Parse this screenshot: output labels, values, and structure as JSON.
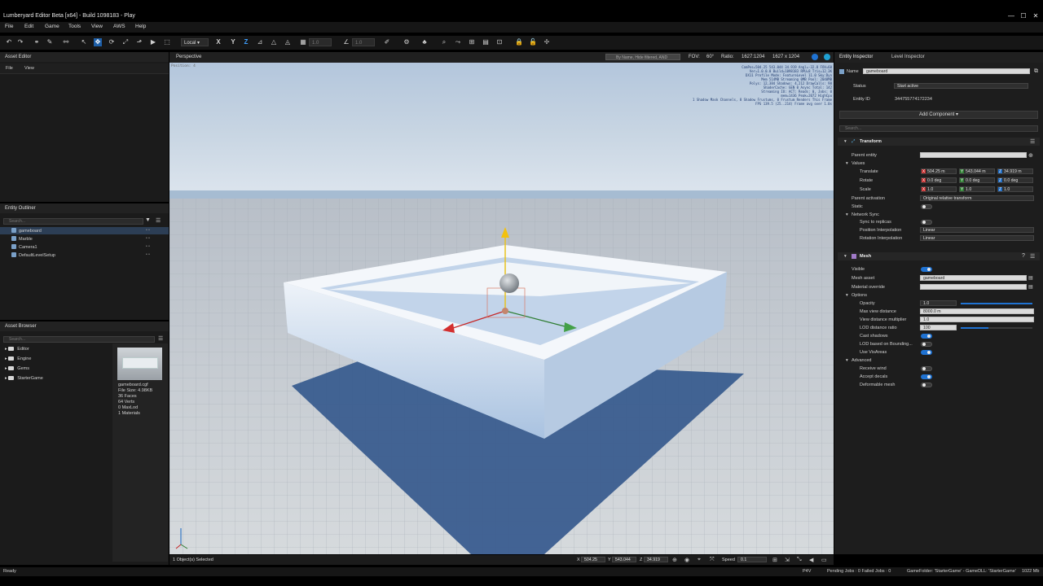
{
  "window": {
    "title": "Lumberyard Editor Beta [x64] - Build 1098183 - Play",
    "controls": [
      "—",
      "☐",
      "✕"
    ]
  },
  "menu": [
    "File",
    "Edit",
    "Game",
    "Tools",
    "View",
    "AWS",
    "Help"
  ],
  "toolbar": {
    "coord_space": "Local",
    "axis_x": "X",
    "axis_y": "Y",
    "axis_z": "Z",
    "grid_value": "1.0",
    "angle_value": "1.0"
  },
  "asset_editor": {
    "title": "Asset Editor",
    "menu": [
      "File",
      "View"
    ]
  },
  "entity_outliner": {
    "title": "Entity Outliner",
    "search_placeholder": "Search...",
    "items": [
      "gameboard",
      "Marble",
      "Camera1",
      "DefaultLevelSetup"
    ]
  },
  "asset_browser": {
    "title": "Asset Browser",
    "search_placeholder": "Search...",
    "folders": [
      "Editor",
      "Engine",
      "Gems",
      "StarterGame"
    ],
    "preview": {
      "filename": "gameboard.cgf",
      "lines": [
        "File Size: 4.98KB",
        "36 Faces",
        "64 Verts",
        "0 MaxLod",
        "1 Materials"
      ]
    }
  },
  "viewport": {
    "title": "Perspective",
    "search_placeholder": "By Name, Hide filtered, AND",
    "fov_label": "FOV:",
    "fov_value": "60°",
    "ratio_label": "Ratio:",
    "ratio_value": "1627:1204",
    "resolution": "1627 x 1204",
    "position_readout": "Position: 4",
    "debug_lines": [
      "CamPos=504.25 543.044 34.919 Angl=-32.8 FOV=60",
      "Ver=1.0.0.0 Build=1098183 RPU=8 Tris=12.3K",
      "DX11 Profile Mode: FeatureLevel 11.0 Sky:Dyn",
      "Mem 514MB Streaming 0MB Pool: 2048MB",
      "Polys: 12,384 Shadows: 4,212 DrawCalls: 98",
      "ShaderCache: GEN 0 Async Total: 142",
      "Streaming IO: ACT: Reads: 0, Jobs: 0",
      "mem=1436 Peak=2072 HighCpu",
      "1 Shadow Mask Channels, 8 Shadow Frustums, 0 Frustum Renders This Frame",
      "FPS 139.5 (25..214)  Frame avg over 1.0s"
    ],
    "status": "1 Object(s) Selected",
    "coords": {
      "x_label": "X",
      "x": "504.25",
      "y_label": "Y",
      "y": "543.044",
      "z_label": "Z",
      "z": "34.919"
    },
    "speed_label": "Speed",
    "speed_value": "0.1"
  },
  "inspector": {
    "tabs": [
      "Entity Inspector",
      "Level Inspector"
    ],
    "name_label": "Name",
    "name_value": "gameboard",
    "status_label": "Status",
    "status_value": "Start active",
    "entity_id_label": "Entity ID",
    "entity_id_value": "344755774172234",
    "add_component": "Add Component ▾",
    "search_placeholder": "Search...",
    "transform": {
      "title": "Transform",
      "parent_entity": "Parent entity",
      "values": "Values",
      "translate": "Translate",
      "translate_vals": [
        "504.25 m",
        "543.044 m",
        "34.919 m"
      ],
      "rotate": "Rotate",
      "rotate_vals": [
        "0.0 deg",
        "0.0 deg",
        "0.0 deg"
      ],
      "scale": "Scale",
      "scale_vals": [
        "1.0",
        "1.0",
        "1.0"
      ],
      "parent_activation": "Parent activation",
      "parent_activation_value": "Original relative transform",
      "static": "Static",
      "network_sync": "Network Sync",
      "sync_replicas": "Sync to replicas",
      "pos_interp": "Position Interpolation",
      "pos_interp_value": "Linear",
      "rot_interp": "Rotation Interpolation",
      "rot_interp_value": "Linear"
    },
    "mesh": {
      "title": "Mesh",
      "visible": "Visible",
      "mesh_asset": "Mesh asset",
      "mesh_asset_value": "gameboard",
      "material_override": "Material override",
      "options": "Options",
      "opacity": "Opacity",
      "opacity_value": "1.0",
      "max_view_distance": "Max view distance",
      "max_view_distance_value": "8000.0 m",
      "view_distance_multiplier": "View distance multiplier",
      "view_distance_multiplier_value": "1.0",
      "lod_ratio": "LOD distance ratio",
      "lod_ratio_value": "100",
      "cast_shadows": "Cast shadows",
      "lod_bbox": "LOD based on Bounding...",
      "use_visareas": "Use VisAreas",
      "advanced": "Advanced",
      "receive_wind": "Receive wind",
      "accept_decals": "Accept decals",
      "deformable": "Deformable mesh",
      "opacity_level": 1.0,
      "lod_ratio_level": 0.39
    }
  },
  "statusbar": {
    "left": "Ready",
    "p4v": "P4V",
    "jobs": "Pending Jobs : 0  Failed Jobs : 0",
    "game_folder": "GameFolder: 'StarterGame' - GameDLL: 'StarterGame'",
    "mem": "1022 Mb"
  },
  "colors": {
    "accent": "#1f72d2",
    "x_axis": "#c62828",
    "y_axis": "#2e7d32",
    "z_axis": "#1565c0"
  }
}
